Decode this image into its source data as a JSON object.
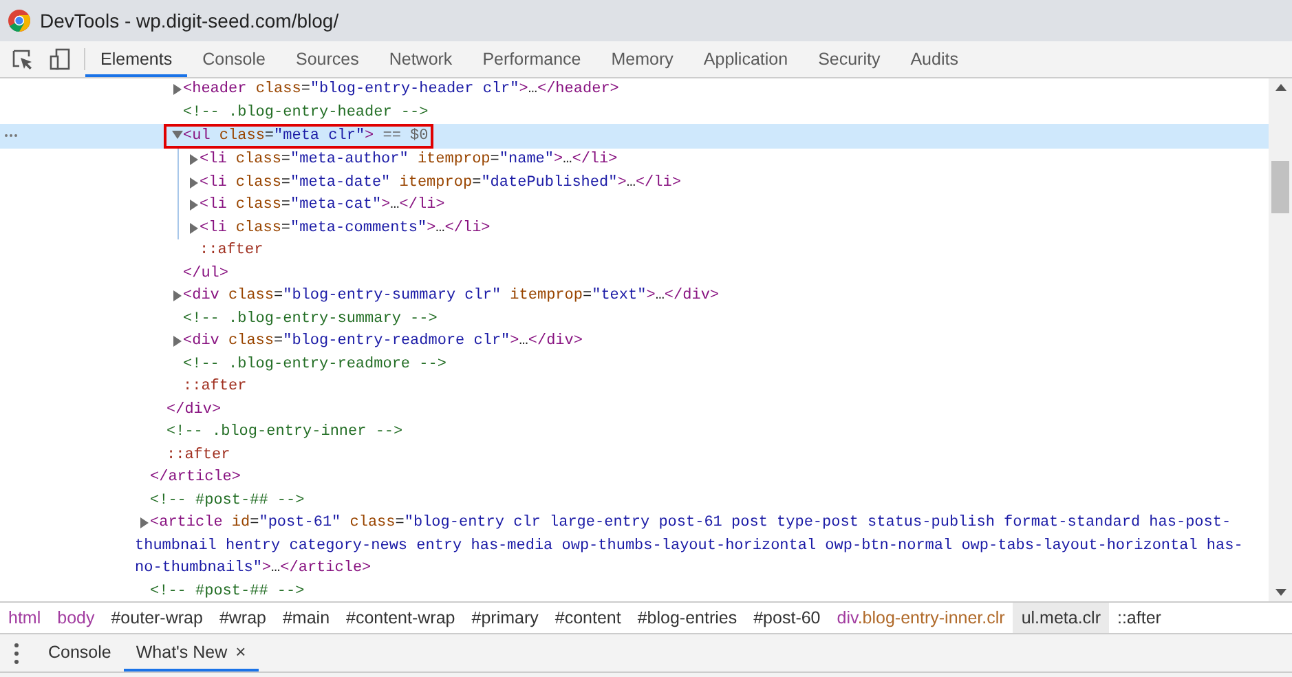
{
  "window": {
    "title": "DevTools - wp.digit-seed.com/blog/"
  },
  "tabs": [
    {
      "label": "Elements",
      "selected": true
    },
    {
      "label": "Console",
      "selected": false
    },
    {
      "label": "Sources",
      "selected": false
    },
    {
      "label": "Network",
      "selected": false
    },
    {
      "label": "Performance",
      "selected": false
    },
    {
      "label": "Memory",
      "selected": false
    },
    {
      "label": "Application",
      "selected": false
    },
    {
      "label": "Security",
      "selected": false
    },
    {
      "label": "Audits",
      "selected": false
    }
  ],
  "dom_tree": [
    {
      "children": [
        {
          "children": [
            {
              "expanded": false,
              "selected": false,
              "tokens": [
                {
                  "kind": "tag",
                  "text": "<header"
                },
                {
                  "kind": "attr",
                  "text": " class"
                },
                {
                  "kind": "punct",
                  "text": "="
                },
                {
                  "kind": "value",
                  "text": "\"blog-entry-header clr\""
                },
                {
                  "kind": "tag",
                  "text": ">"
                },
                {
                  "kind": "text",
                  "text": "…"
                },
                {
                  "kind": "tag",
                  "text": "</header>"
                }
              ]
            },
            {
              "selected": false,
              "tokens": [
                {
                  "kind": "comment",
                  "text": "<!-- .blog-entry-header -->"
                }
              ]
            },
            {
              "expanded": true,
              "selected": true,
              "outlined": true,
              "tokens": [
                {
                  "kind": "tag",
                  "text": "<ul"
                },
                {
                  "kind": "attr",
                  "text": " class"
                },
                {
                  "kind": "punct",
                  "text": "="
                },
                {
                  "kind": "value",
                  "text": "\"meta clr\""
                },
                {
                  "kind": "tag",
                  "text": ">"
                },
                {
                  "kind": "hint",
                  "text": " == $0"
                }
              ],
              "children": [
                {
                  "expanded": false,
                  "selected": false,
                  "tokens": [
                    {
                      "kind": "tag",
                      "text": "<li"
                    },
                    {
                      "kind": "attr",
                      "text": " class"
                    },
                    {
                      "kind": "punct",
                      "text": "="
                    },
                    {
                      "kind": "value",
                      "text": "\"meta-author\""
                    },
                    {
                      "kind": "attr",
                      "text": " itemprop"
                    },
                    {
                      "kind": "punct",
                      "text": "="
                    },
                    {
                      "kind": "value",
                      "text": "\"name\""
                    },
                    {
                      "kind": "tag",
                      "text": ">"
                    },
                    {
                      "kind": "text",
                      "text": "…"
                    },
                    {
                      "kind": "tag",
                      "text": "</li>"
                    }
                  ]
                },
                {
                  "expanded": false,
                  "selected": false,
                  "tokens": [
                    {
                      "kind": "tag",
                      "text": "<li"
                    },
                    {
                      "kind": "attr",
                      "text": " class"
                    },
                    {
                      "kind": "punct",
                      "text": "="
                    },
                    {
                      "kind": "value",
                      "text": "\"meta-date\""
                    },
                    {
                      "kind": "attr",
                      "text": " itemprop"
                    },
                    {
                      "kind": "punct",
                      "text": "="
                    },
                    {
                      "kind": "value",
                      "text": "\"datePublished\""
                    },
                    {
                      "kind": "tag",
                      "text": ">"
                    },
                    {
                      "kind": "text",
                      "text": "…"
                    },
                    {
                      "kind": "tag",
                      "text": "</li>"
                    }
                  ]
                },
                {
                  "expanded": false,
                  "selected": false,
                  "tokens": [
                    {
                      "kind": "tag",
                      "text": "<li"
                    },
                    {
                      "kind": "attr",
                      "text": " class"
                    },
                    {
                      "kind": "punct",
                      "text": "="
                    },
                    {
                      "kind": "value",
                      "text": "\"meta-cat\""
                    },
                    {
                      "kind": "tag",
                      "text": ">"
                    },
                    {
                      "kind": "text",
                      "text": "…"
                    },
                    {
                      "kind": "tag",
                      "text": "</li>"
                    }
                  ]
                },
                {
                  "expanded": false,
                  "selected": false,
                  "tokens": [
                    {
                      "kind": "tag",
                      "text": "<li"
                    },
                    {
                      "kind": "attr",
                      "text": " class"
                    },
                    {
                      "kind": "punct",
                      "text": "="
                    },
                    {
                      "kind": "value",
                      "text": "\"meta-comments\""
                    },
                    {
                      "kind": "tag",
                      "text": ">"
                    },
                    {
                      "kind": "text",
                      "text": "…"
                    },
                    {
                      "kind": "tag",
                      "text": "</li>"
                    }
                  ]
                },
                {
                  "selected": false,
                  "tokens": [
                    {
                      "kind": "pseudo",
                      "text": "::after"
                    }
                  ]
                }
              ],
              "close": [
                {
                  "kind": "tag",
                  "text": "</ul>"
                }
              ]
            },
            {
              "expanded": false,
              "selected": false,
              "tokens": [
                {
                  "kind": "tag",
                  "text": "<div"
                },
                {
                  "kind": "attr",
                  "text": " class"
                },
                {
                  "kind": "punct",
                  "text": "="
                },
                {
                  "kind": "value",
                  "text": "\"blog-entry-summary clr\""
                },
                {
                  "kind": "attr",
                  "text": " itemprop"
                },
                {
                  "kind": "punct",
                  "text": "="
                },
                {
                  "kind": "value",
                  "text": "\"text\""
                },
                {
                  "kind": "tag",
                  "text": ">"
                },
                {
                  "kind": "text",
                  "text": "…"
                },
                {
                  "kind": "tag",
                  "text": "</div>"
                }
              ]
            },
            {
              "selected": false,
              "tokens": [
                {
                  "kind": "comment",
                  "text": "<!-- .blog-entry-summary -->"
                }
              ]
            },
            {
              "expanded": false,
              "selected": false,
              "tokens": [
                {
                  "kind": "tag",
                  "text": "<div"
                },
                {
                  "kind": "attr",
                  "text": " class"
                },
                {
                  "kind": "punct",
                  "text": "="
                },
                {
                  "kind": "value",
                  "text": "\"blog-entry-readmore clr\""
                },
                {
                  "kind": "tag",
                  "text": ">"
                },
                {
                  "kind": "text",
                  "text": "…"
                },
                {
                  "kind": "tag",
                  "text": "</div>"
                }
              ]
            },
            {
              "selected": false,
              "tokens": [
                {
                  "kind": "comment",
                  "text": "<!-- .blog-entry-readmore -->"
                }
              ]
            },
            {
              "selected": false,
              "tokens": [
                {
                  "kind": "pseudo",
                  "text": "::after"
                }
              ]
            }
          ],
          "close": [
            {
              "kind": "tag",
              "text": "</div>"
            }
          ]
        },
        {
          "selected": false,
          "tokens": [
            {
              "kind": "comment",
              "text": "<!-- .blog-entry-inner -->"
            }
          ]
        },
        {
          "selected": false,
          "tokens": [
            {
              "kind": "pseudo",
              "text": "::after"
            }
          ]
        }
      ],
      "close": [
        {
          "kind": "tag",
          "text": "</article>"
        }
      ]
    },
    {
      "selected": false,
      "tokens": [
        {
          "kind": "comment",
          "text": "<!-- #post-## -->"
        }
      ]
    },
    {
      "expanded": false,
      "selected": false,
      "tokens": [
        {
          "kind": "tag",
          "text": "<article"
        },
        {
          "kind": "attr",
          "text": " id"
        },
        {
          "kind": "punct",
          "text": "="
        },
        {
          "kind": "value",
          "text": "\"post-61\""
        },
        {
          "kind": "attr",
          "text": " class"
        },
        {
          "kind": "punct",
          "text": "="
        },
        {
          "kind": "value",
          "text": "\"blog-entry clr large-entry post-61 post type-post status-publish format-standard has-post-thumbnail hentry category-news entry has-media owp-thumbs-layout-horizontal owp-btn-normal owp-tabs-layout-horizontal has-no-thumbnails\""
        },
        {
          "kind": "tag",
          "text": ">"
        },
        {
          "kind": "text",
          "text": "…"
        },
        {
          "kind": "tag",
          "text": "</article>"
        }
      ]
    },
    {
      "selected": false,
      "tokens": [
        {
          "kind": "comment",
          "text": "<!-- #post-## -->"
        }
      ]
    }
  ],
  "breadcrumbs": [
    {
      "selected": false,
      "parts": [
        {
          "kind": "tag",
          "text": "html"
        }
      ]
    },
    {
      "selected": false,
      "parts": [
        {
          "kind": "tag",
          "text": "body"
        }
      ]
    },
    {
      "selected": false,
      "parts": [
        {
          "kind": "id",
          "text": "#outer-wrap"
        }
      ]
    },
    {
      "selected": false,
      "parts": [
        {
          "kind": "id",
          "text": "#wrap"
        }
      ]
    },
    {
      "selected": false,
      "parts": [
        {
          "kind": "id",
          "text": "#main"
        }
      ]
    },
    {
      "selected": false,
      "parts": [
        {
          "kind": "id",
          "text": "#content-wrap"
        }
      ]
    },
    {
      "selected": false,
      "parts": [
        {
          "kind": "id",
          "text": "#primary"
        }
      ]
    },
    {
      "selected": false,
      "parts": [
        {
          "kind": "id",
          "text": "#content"
        }
      ]
    },
    {
      "selected": false,
      "parts": [
        {
          "kind": "id",
          "text": "#blog-entries"
        }
      ]
    },
    {
      "selected": false,
      "parts": [
        {
          "kind": "id",
          "text": "#post-60"
        }
      ]
    },
    {
      "selected": false,
      "parts": [
        {
          "kind": "tag",
          "text": "div"
        },
        {
          "kind": "class",
          "text": ".blog-entry-inner.clr"
        }
      ]
    },
    {
      "selected": true,
      "parts": [
        {
          "kind": "id",
          "text": "ul.meta.clr"
        }
      ]
    },
    {
      "selected": false,
      "parts": [
        {
          "kind": "id",
          "text": "::after"
        }
      ]
    }
  ],
  "drawer_tabs": [
    {
      "label": "Console",
      "selected": false
    },
    {
      "label": "What's New",
      "selected": true,
      "close": "×"
    }
  ]
}
